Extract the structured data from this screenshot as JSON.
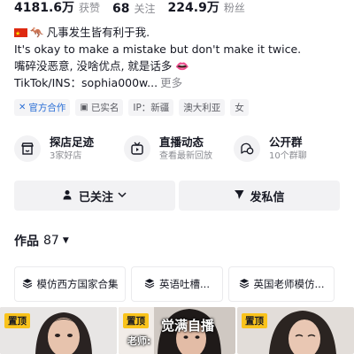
{
  "stats": [
    {
      "value": "4181.6万",
      "label": "获赞"
    },
    {
      "value": "68",
      "label": "关注"
    },
    {
      "value": "224.9万",
      "label": "粉丝"
    }
  ],
  "bio": {
    "line1": "凡事发生皆有利于我.",
    "line2": "It's okay to make a mistake but don't make it twice.",
    "line3": "嘴碎没恶意, 没啥优点, 就是话多",
    "line4": "TikTok/INS：sophia000w...",
    "more": "更多"
  },
  "tags": [
    {
      "label": "官方合作",
      "icon": "verified-icon"
    },
    {
      "label": "已实名",
      "icon": "id-card-icon"
    },
    {
      "label": "IP：新疆"
    },
    {
      "label": "澳大利亚"
    },
    {
      "label": "女"
    }
  ],
  "features": [
    {
      "title": "探店足迹",
      "subtitle": "3家好店",
      "icon": "store-icon"
    },
    {
      "title": "直播动态",
      "subtitle": "查看最新回放",
      "icon": "tv-icon"
    },
    {
      "title": "公开群",
      "subtitle": "10个群聊",
      "icon": "chat-group-icon"
    }
  ],
  "actions": {
    "followed_label": "已关注",
    "message_label": "发私信"
  },
  "works": {
    "label": "作品",
    "count": "87"
  },
  "collections": [
    {
      "label": "模仿西方国家合集"
    },
    {
      "label": "英语吐槽..."
    },
    {
      "label": "英国老师模仿..."
    }
  ],
  "thumbnails": [
    {
      "badge": "置顶"
    },
    {
      "badge": "置顶",
      "overlay": "老师:",
      "overlay2": "觉满自播"
    },
    {
      "badge": "置顶"
    }
  ],
  "colors": {
    "accent": "#2b6fd6",
    "pin_badge": "#f9c31c",
    "text_primary": "#161823",
    "text_secondary": "#8a8b91"
  }
}
